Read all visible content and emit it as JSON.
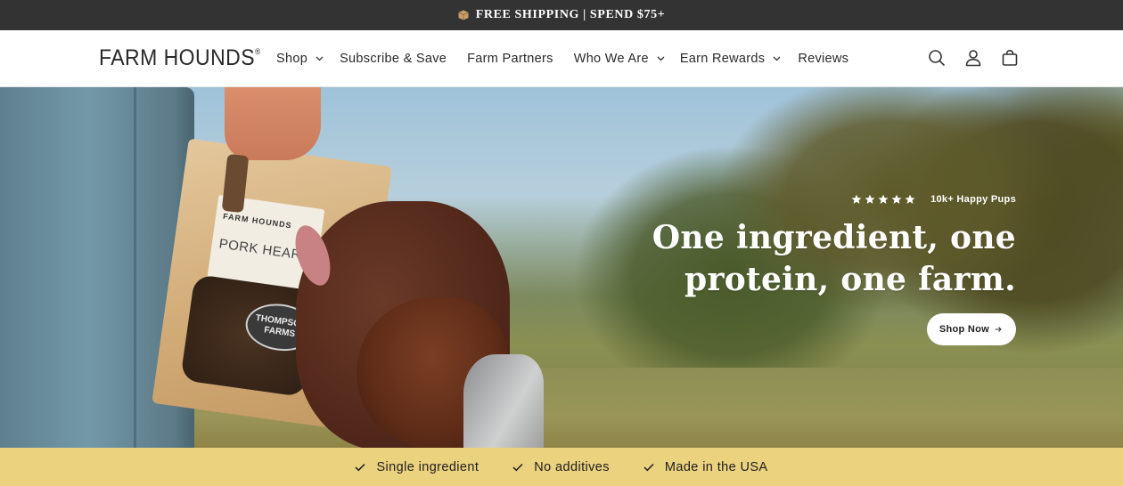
{
  "announcement": {
    "text": "FREE SHIPPING | SPEND $75+",
    "icon": "box-icon"
  },
  "header": {
    "logo": "FARM HOUNDS",
    "logo_mark": "®",
    "nav": [
      {
        "label": "Shop",
        "dropdown": true
      },
      {
        "label": "Subscribe & Save",
        "dropdown": false
      },
      {
        "label": "Farm Partners",
        "dropdown": false
      },
      {
        "label": "Who We Are",
        "dropdown": true
      },
      {
        "label": "Earn Rewards",
        "dropdown": true
      },
      {
        "label": "Reviews",
        "dropdown": false
      }
    ],
    "icons": [
      "search-icon",
      "account-icon",
      "cart-icon"
    ]
  },
  "hero": {
    "rating_stars": 5,
    "rating_text": "10k+ Happy Pups",
    "headline_line1": "One ingredient, one",
    "headline_line2": "protein, one farm.",
    "cta": "Shop Now",
    "bag_brand": "FARM HOUNDS",
    "bag_product": "PORK HEART",
    "bag_badge_line1": "THOMPSON",
    "bag_badge_line2": "FARMS"
  },
  "features": [
    {
      "label": "Single ingredient"
    },
    {
      "label": "No additives"
    },
    {
      "label": "Made in the USA"
    }
  ],
  "colors": {
    "announcement_bg": "#333333",
    "feature_bar_bg": "#ebd27e",
    "text": "#1e1e1e"
  }
}
